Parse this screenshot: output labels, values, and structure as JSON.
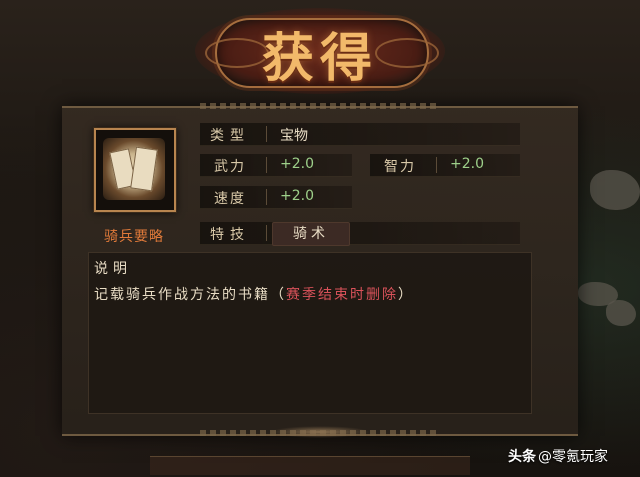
{
  "dialog": {
    "title": "获得"
  },
  "item": {
    "name": "骑兵要略",
    "image_icon": "book-icon"
  },
  "stats": {
    "type_label": "类型",
    "type_value": "宝物",
    "wuli_label": "武力",
    "wuli_value": "+2.0",
    "zhili_label": "智力",
    "zhili_value": "+2.0",
    "sudu_label": "速度",
    "sudu_value": "+2.0",
    "teji_label": "特技",
    "teji_value": "骑术"
  },
  "description": {
    "title": "说明",
    "text": "记载骑兵作战方法的书籍（",
    "red_text": "赛季结束时删除",
    "close_paren": "）"
  },
  "watermark": {
    "brand": "头条",
    "handle": "@零氪玩家"
  },
  "colors": {
    "title_gold": "#f2b96a",
    "item_name_orange": "#e07a3a",
    "stat_green": "#9ed08a",
    "warning_red": "#d9525a"
  }
}
